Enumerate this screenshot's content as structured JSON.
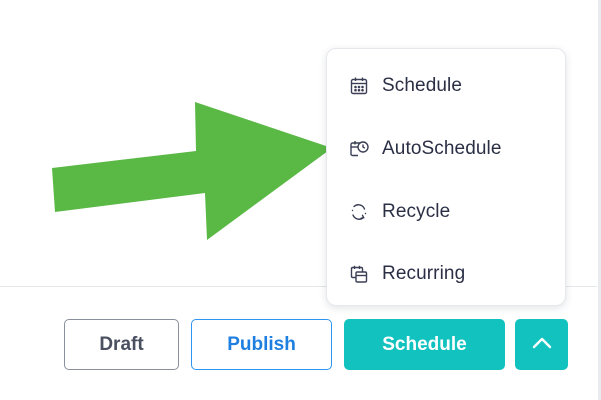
{
  "menu": {
    "items": [
      {
        "label": "Schedule",
        "icon": "calendar-icon"
      },
      {
        "label": "AutoSchedule",
        "icon": "calendar-clock-icon"
      },
      {
        "label": "Recycle",
        "icon": "recycle-icon"
      },
      {
        "label": "Recurring",
        "icon": "recurring-calendar-icon"
      }
    ]
  },
  "footer": {
    "draft_label": "Draft",
    "publish_label": "Publish",
    "schedule_label": "Schedule",
    "toggle_icon": "chevron-up-icon"
  },
  "colors": {
    "accent": "#12c2bf",
    "publish_blue": "#1e7fe0",
    "arrow_green": "#5ab845"
  }
}
